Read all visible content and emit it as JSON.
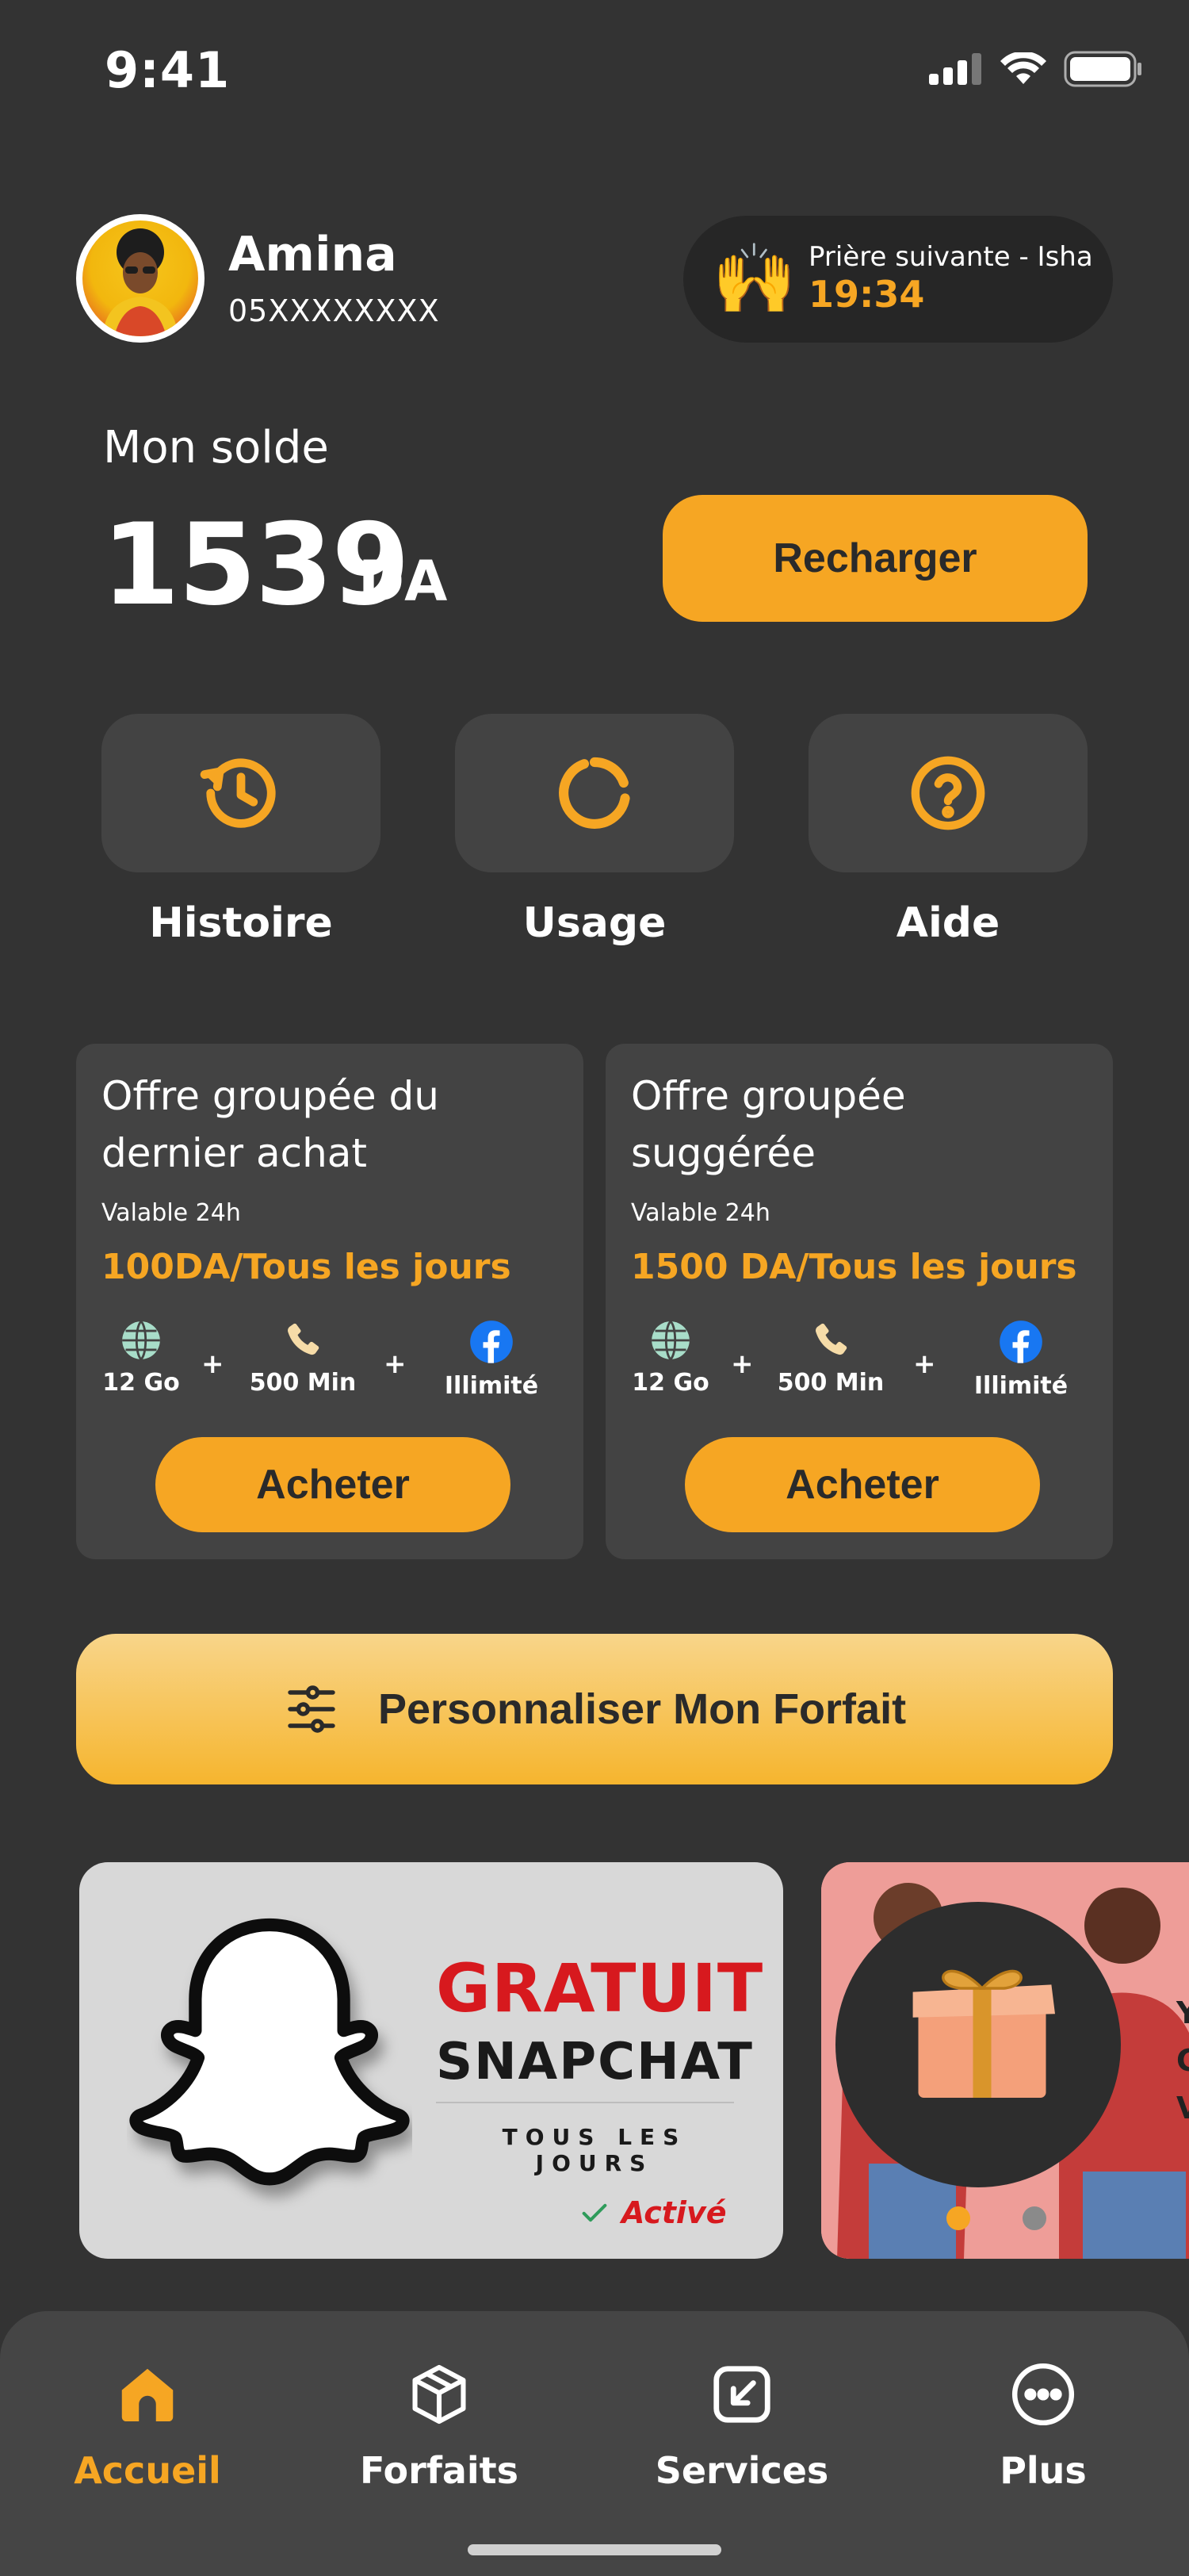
{
  "status_bar": {
    "time": "9:41"
  },
  "header": {
    "user_name": "Amina",
    "phone": "05XXXXXXXX",
    "prayer": {
      "label": "Prière suivante - Isha",
      "time": "19:34",
      "icon": "praying-hands-emoji"
    }
  },
  "balance": {
    "label": "Mon solde",
    "amount": "1539",
    "currency": "DA",
    "recharge_label": "Recharger"
  },
  "quick_actions": [
    {
      "label": "Histoire",
      "icon": "history-icon"
    },
    {
      "label": "Usage",
      "icon": "usage-ring-icon"
    },
    {
      "label": "Aide",
      "icon": "help-icon"
    }
  ],
  "offers": [
    {
      "title_line1": "Offre groupée du",
      "title_line2": "dernier achat",
      "validity": "Valable 24h",
      "price": "100DA/Tous les jours",
      "features": [
        {
          "label": "12 Go",
          "icon": "globe-icon"
        },
        {
          "label": "500 Min",
          "icon": "phone-icon"
        },
        {
          "label": "Illimité",
          "icon": "facebook-icon"
        }
      ],
      "plus": "+",
      "buy_label": "Acheter"
    },
    {
      "title_line1": "Offre groupée",
      "title_line2": "suggérée",
      "validity": "Valable 24h",
      "price": "1500 DA/Tous les jours",
      "features": [
        {
          "label": "12 Go",
          "icon": "globe-icon"
        },
        {
          "label": "500 Min",
          "icon": "phone-icon"
        },
        {
          "label": "Illimité",
          "icon": "facebook-icon"
        }
      ],
      "plus": "+",
      "buy_label": "Acheter"
    }
  ],
  "personalize": {
    "label": "Personnaliser Mon Forfait",
    "icon": "sliders-icon"
  },
  "banners": {
    "snapchat": {
      "headline": "GRATUIT",
      "title": "SNAPCHAT",
      "subtitle": "TOUS LES JOURS",
      "status": "Activé"
    },
    "gift": {
      "icon": "gift-box-icon",
      "partial_text": [
        "Y",
        "C",
        "V"
      ]
    },
    "carousel_active_index": 0
  },
  "bottom_nav": [
    {
      "label": "Accueil",
      "icon": "home-icon",
      "active": true
    },
    {
      "label": "Forfaits",
      "icon": "package-icon",
      "active": false
    },
    {
      "label": "Services",
      "icon": "services-arrow-icon",
      "active": false
    },
    {
      "label": "Plus",
      "icon": "more-dots-icon",
      "active": false
    }
  ],
  "colors": {
    "background": "#333333",
    "card": "#434343",
    "accent": "#f6a623",
    "nav": "#454545",
    "snap_red": "#d7191e"
  }
}
